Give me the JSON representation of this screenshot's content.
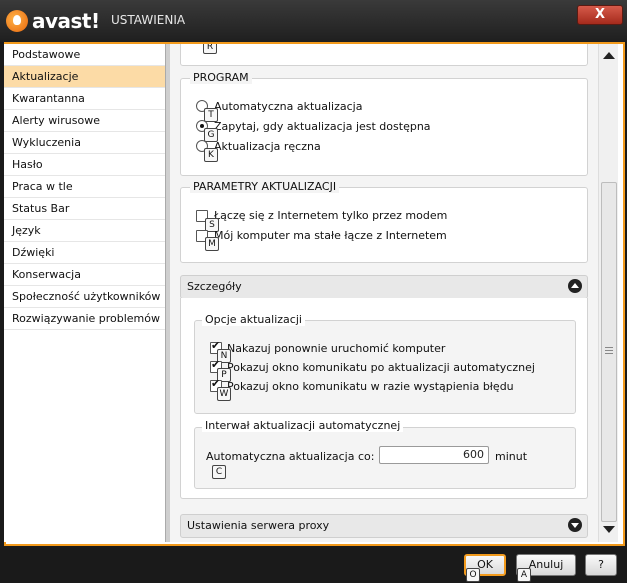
{
  "window": {
    "logo_text": "avast!",
    "title": "USTAWIENIA",
    "close_symbol": "X"
  },
  "sidebar": {
    "items": [
      {
        "label": "Podstawowe"
      },
      {
        "label": "Aktualizacje"
      },
      {
        "label": "Kwarantanna"
      },
      {
        "label": "Alerty wirusowe"
      },
      {
        "label": "Wykluczenia"
      },
      {
        "label": "Hasło"
      },
      {
        "label": "Praca w tle"
      },
      {
        "label": "Status Bar"
      },
      {
        "label": "Język"
      },
      {
        "label": "Dźwięki"
      },
      {
        "label": "Konserwacja"
      },
      {
        "label": "Społeczność użytkowników"
      },
      {
        "label": "Rozwiązywanie problemów"
      }
    ],
    "active_index": 1
  },
  "content": {
    "top_key": "R",
    "program": {
      "title": "PROGRAM",
      "options": [
        {
          "label": "Automatyczna aktualizacja",
          "key": "T",
          "selected": false
        },
        {
          "label": "Zapytaj, gdy aktualizacja jest dostępna",
          "key": "G",
          "selected": true
        },
        {
          "label": "Aktualizacja ręczna",
          "key": "K",
          "selected": false
        }
      ]
    },
    "params": {
      "title": "PARAMETRY AKTUALIZACJI",
      "options": [
        {
          "label": "Łączę się z Internetem tylko przez modem",
          "key": "S",
          "checked": false
        },
        {
          "label": "Mój komputer ma stałe łącze z Internetem",
          "key": "M",
          "checked": false
        }
      ]
    },
    "details": {
      "title": "Szczegóły",
      "update_options": {
        "title": "Opcje aktualizacji",
        "options": [
          {
            "label": "Nakazuj ponownie uruchomić komputer",
            "key": "N",
            "checked": true
          },
          {
            "label": "Pokazuj okno komunikatu po aktualizacji automatycznej",
            "key": "P",
            "checked": true
          },
          {
            "label": "Pokazuj okno komunikatu w razie wystąpienia błędu",
            "key": "W",
            "checked": true
          }
        ]
      },
      "interval": {
        "title": "Interwał aktualizacji automatycznej",
        "label": "Automatyczna aktualizacja co:",
        "value": "600",
        "unit": "minut",
        "key": "C"
      }
    },
    "proxy": {
      "title": "Ustawienia serwera proxy"
    }
  },
  "footer": {
    "ok_label": "OK",
    "ok_key": "O",
    "cancel_label": "Anuluj",
    "cancel_key": "A",
    "help_label": "?"
  },
  "colors": {
    "accent": "#f29a1c",
    "active_item_bg": "#fcdba6",
    "titlebar": "#2a2a2a"
  }
}
